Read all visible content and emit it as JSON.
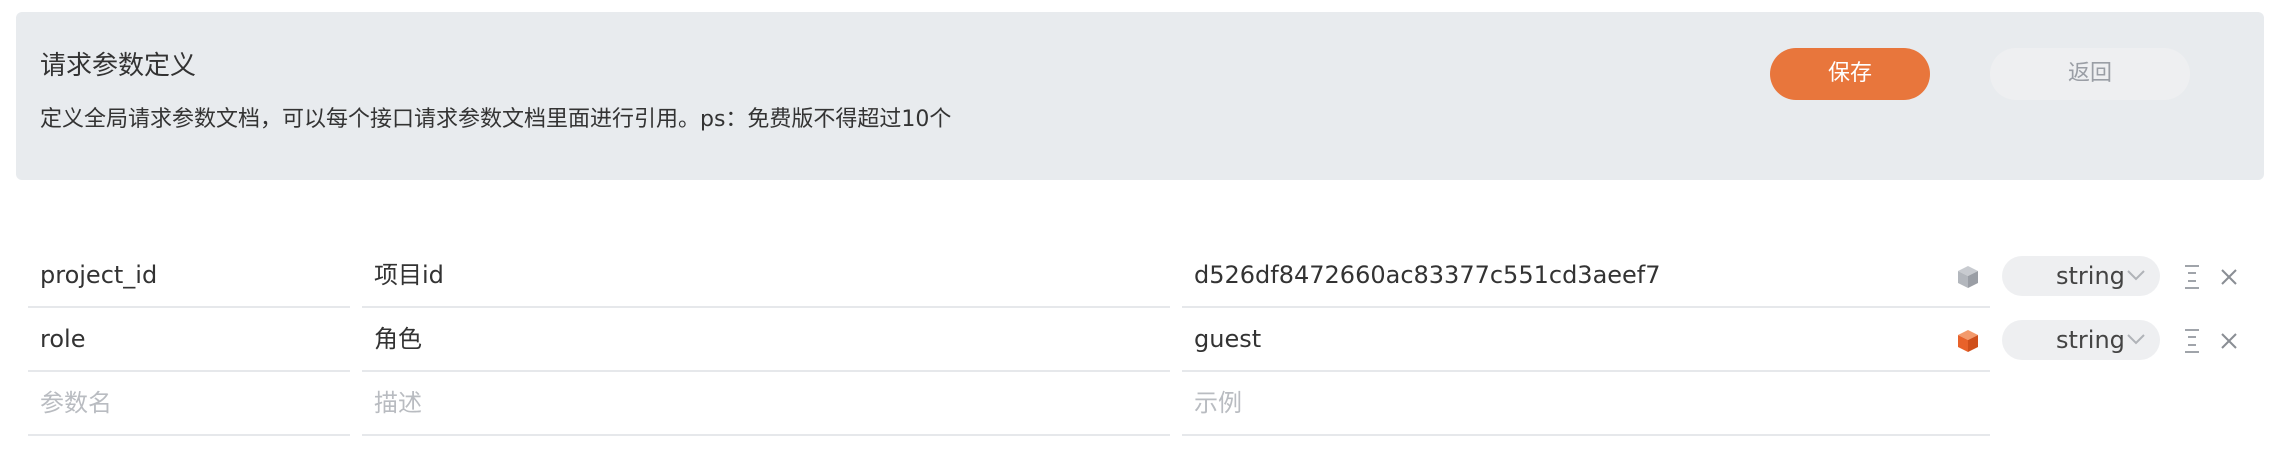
{
  "header": {
    "title": "请求参数定义",
    "description": "定义全局请求参数文档，可以每个接口请求参数文档里面进行引用。ps：免费版不得超过10个",
    "save_label": "保存",
    "back_label": "返回"
  },
  "params": [
    {
      "name": "project_id",
      "description": "项目id",
      "example": "d526df8472660ac83377c551cd3aeef7",
      "type": "string",
      "required": false
    },
    {
      "name": "role",
      "description": "角色",
      "example": "guest",
      "type": "string",
      "required": true
    }
  ],
  "new_param": {
    "name_placeholder": "参数名",
    "desc_placeholder": "描述",
    "example_placeholder": "示例"
  },
  "colors": {
    "accent": "#e8763c",
    "panel_bg": "#e8ebee",
    "required_icon": "#e8622a",
    "optional_icon": "#9a9ea5"
  },
  "icons": {
    "required_toggle": "cube-icon",
    "type_dropdown": "chevron-down-icon",
    "drag": "drag-handle-icon",
    "delete": "close-icon"
  }
}
